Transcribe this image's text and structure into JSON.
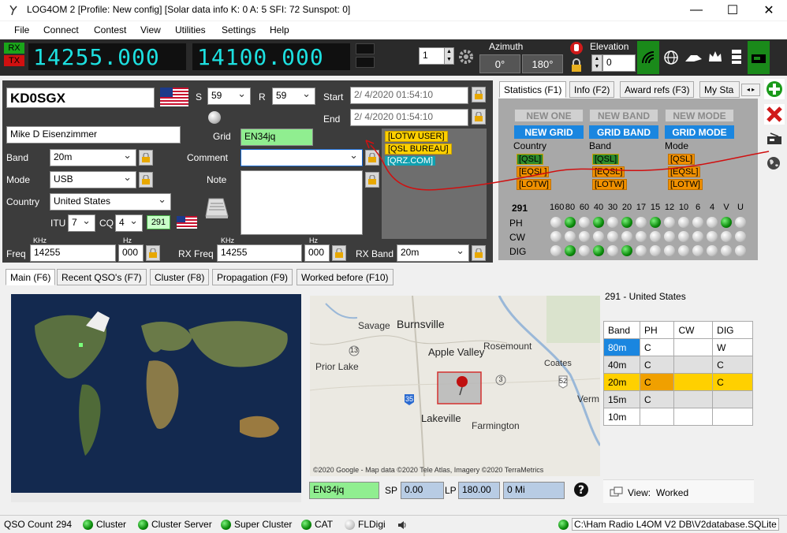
{
  "window": {
    "title": "LOG4OM 2 [Profile: New config] [Solar data info K: 0 A: 5 SFI: 72 Sunspot: 0]",
    "minimize": "—",
    "maximize": "☐",
    "close": "✕"
  },
  "menu": [
    "File",
    "Connect",
    "Contest",
    "View",
    "Utilities",
    "Settings",
    "Help"
  ],
  "toolbar": {
    "rx": "RX",
    "tx": "TX",
    "freq_rx": "14255.000",
    "freq_tx": "14100.000",
    "spin_value": "1",
    "azimuth_label": "Azimuth",
    "azimuth_value": "0°",
    "azimuth_reverse": "180°",
    "elevation_label": "Elevation",
    "elevation_value": "0"
  },
  "qso": {
    "callsign": "KD0SGX",
    "s_label": "S",
    "s_value": "59",
    "r_label": "R",
    "r_value": "59",
    "start_label": "Start",
    "start_value": "2/ 4/2020 01:54:10",
    "end_label": "End",
    "end_value": "2/ 4/2020 01:54:10",
    "name": "Mike D Eisenzimmer",
    "grid_label": "Grid",
    "grid_value": "EN34jq",
    "band_label": "Band",
    "band_value": "20m",
    "comment_label": "Comment",
    "comment_value": "",
    "mode_label": "Mode",
    "mode_value": "USB",
    "note_label": "Note",
    "note_value": "",
    "country_label": "Country",
    "country_value": "United States",
    "itu_label": "ITU",
    "itu_value": "7",
    "cq_label": "CQ",
    "cq_value": "4",
    "dxcc": "291",
    "freq_unit_khz": "KHz",
    "freq_unit_hz": "Hz",
    "freq_label": "Freq",
    "freq_khz": "14255",
    "freq_hz": "000",
    "rxfreq_label": "RX Freq",
    "rxfreq_khz": "14255",
    "rxfreq_hz": "000",
    "rxband_label": "RX Band",
    "rxband_value": "20m",
    "tags": [
      "[LOTW USER]",
      "[QSL BUREAU]",
      "[QRZ.COM]"
    ]
  },
  "stats": {
    "tabs": [
      "Statistics (F1)",
      "Info (F2)",
      "Award refs (F3)",
      "My Sta"
    ],
    "row1": [
      "NEW ONE",
      "NEW BAND",
      "NEW MODE"
    ],
    "row2": [
      "NEW GRID",
      "GRID BAND",
      "GRID MODE"
    ],
    "col_labels": [
      "Country",
      "Band",
      "Mode"
    ],
    "qsl_rows": [
      [
        "[QSL]",
        "[QSL]",
        "[QSL]"
      ],
      [
        "[EQSL]",
        "[EQSL]",
        "[EQSL]"
      ],
      [
        "[LOTW]",
        "[LOTW]",
        "[LOTW]"
      ]
    ],
    "dxcc": "291",
    "bands": [
      "160",
      "80",
      "60",
      "40",
      "30",
      "20",
      "17",
      "15",
      "12",
      "10",
      "6",
      "4",
      "V",
      "U"
    ],
    "modes": [
      {
        "label": "PH",
        "leds": [
          0,
          1,
          0,
          1,
          0,
          1,
          0,
          1,
          0,
          0,
          0,
          0,
          1,
          0
        ]
      },
      {
        "label": "CW",
        "leds": [
          0,
          0,
          0,
          0,
          0,
          0,
          0,
          0,
          0,
          0,
          0,
          0,
          0,
          0
        ]
      },
      {
        "label": "DIG",
        "leds": [
          0,
          1,
          0,
          1,
          0,
          1,
          0,
          0,
          0,
          0,
          0,
          0,
          0,
          0
        ]
      }
    ]
  },
  "lower_tabs": [
    "Main (F6)",
    "Recent QSO's (F7)",
    "Cluster (F8)",
    "Propagation (F9)",
    "Worked before (F10)"
  ],
  "map": {
    "places": [
      "Savage",
      "Burnsville",
      "Apple Valley",
      "Rosemount",
      "Prior Lake",
      "Coates",
      "Lakeville",
      "Farmington",
      "Verm"
    ],
    "roads": [
      "13",
      "3",
      "52",
      "35"
    ],
    "copyright": "©2020 Google - Map data ©2020 Tele Atlas, Imagery ©2020 TerraMetrics",
    "grid": "EN34jq",
    "sp_label": "SP",
    "sp_value": "0.00",
    "lp_label": "LP",
    "lp_value": "180.00",
    "distance": "0 Mi"
  },
  "worked": {
    "title": "291 - United States",
    "headers": [
      "Band",
      "PH",
      "CW",
      "DIG"
    ],
    "rows": [
      [
        "80m",
        "C",
        "",
        "W"
      ],
      [
        "40m",
        "C",
        "",
        "C"
      ],
      [
        "20m",
        "C",
        "",
        "C"
      ],
      [
        "15m",
        "C",
        "",
        ""
      ],
      [
        "10m",
        "",
        "",
        ""
      ]
    ],
    "view_label": "View:",
    "view_value": "Worked"
  },
  "status": {
    "qso_count_label": "QSO Count",
    "qso_count": "294",
    "items": [
      "Cluster",
      "Cluster Server",
      "Super Cluster",
      "CAT",
      "FLDigi"
    ],
    "db_path": "C:\\Ham Radio L4OM V2 DB\\V2database.SQLite"
  }
}
